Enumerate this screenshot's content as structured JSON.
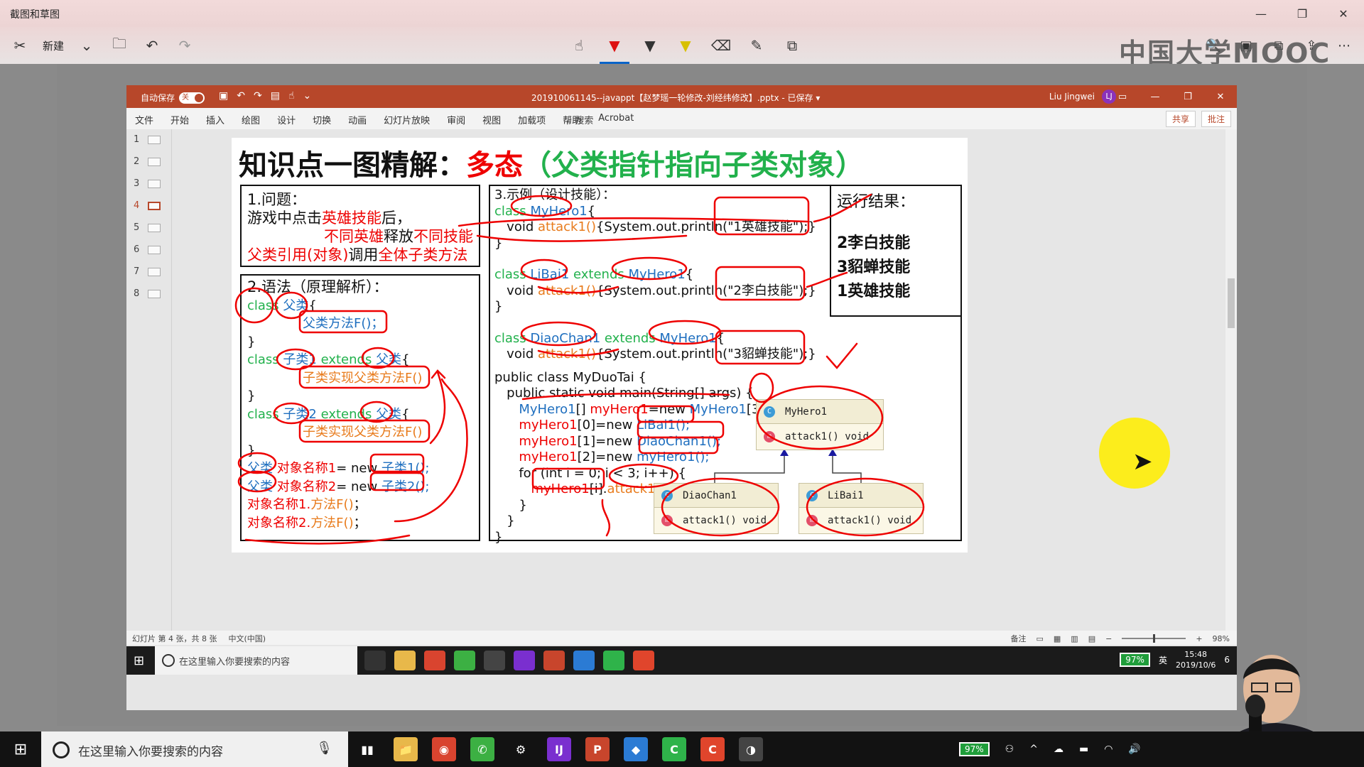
{
  "snip": {
    "title": "截图和草图",
    "new_label": "新建",
    "win_min": "—",
    "win_max": "❐",
    "win_close": "✕",
    "watermark": "中国大学MOOC",
    "icons": {
      "new": "✂",
      "chevron": "⌄",
      "folder": "🗀",
      "undo": "↶",
      "redo": "↷",
      "touch": "☝",
      "pen": "▼",
      "pencil": "▼",
      "highlighter": "▼",
      "eraser": "⌫",
      "ruler": "✎",
      "crop": "⧉",
      "zoom": "🔍",
      "save": "▣",
      "copy": "⧉",
      "share": "⇪",
      "more": "⋯"
    }
  },
  "ppt": {
    "autosave_label": "自动保存",
    "autosave_state": "关",
    "doc_name": "201910061145--javappt【赵梦瑶一轮修改-刘经纬修改】.pptx - 已保存 ▾",
    "user_name": "Liu Jingwei",
    "user_initial": "LJ",
    "ribbon_tabs": [
      "文件",
      "开始",
      "插入",
      "绘图",
      "设计",
      "切换",
      "动画",
      "幻灯片放映",
      "审阅",
      "视图",
      "加载项",
      "帮助",
      "Acrobat"
    ],
    "search_label": "搜索",
    "share_label": "共享",
    "comment_label": "批注",
    "thumbnails": [
      "1",
      "2",
      "3",
      "4",
      "5",
      "6",
      "7",
      "8"
    ],
    "active_slide": 4,
    "status_slide": "幻灯片 第 4 张，共 8 张",
    "status_lang": "中文(中国)",
    "status_notes": "备注",
    "zoom": "98%"
  },
  "slide": {
    "title_black": "知识点一图精解：",
    "title_red": "多态",
    "title_green": "（父类指针指向子类对象）",
    "box1": {
      "heading": "1.问题：",
      "l1_a": "游戏中点击",
      "l1_b": "英雄技能",
      "l1_c": "后，",
      "l2_a": "不同英雄",
      "l2_b": "释放",
      "l2_c": "不同技能",
      "l3_a": "父类引用(对象)",
      "l3_b": "调用",
      "l3_c": "全体子类方法"
    },
    "box2": {
      "heading": "2.语法（原理解析）：",
      "l1_kw": "class ",
      "l1_name": "父类",
      "l1_end": "{",
      "l2": "父类方法F()；",
      "l3": "}",
      "l4_kw": "class ",
      "l4_name": "子类1",
      "l4_ext": " extends ",
      "l4_parent": "父类",
      "l4_end": "{",
      "l5": "子类实现父类方法F()",
      "l6": "}",
      "l7_kw": "class ",
      "l7_name": "子类2",
      "l7_ext": " extends ",
      "l7_parent": "父类",
      "l7_end": "{",
      "l8": "子类实现父类方法F()",
      "l9": "}",
      "l10_a": "父类",
      "l10_b": " 对象名称1",
      "l10_c": "= new ",
      "l10_d": "子类1();",
      "l11_a": "父类",
      "l11_b": " 对象名称2",
      "l11_c": "= new ",
      "l11_d": "子类2();",
      "l12_a": "对象名称1.",
      "l12_b": "方法F()",
      "l12_c": "；",
      "l13_a": "对象名称2.",
      "l13_b": "方法F()",
      "l13_c": "；"
    },
    "box3": {
      "heading": "3.示例（设计技能）：",
      "c1_kw": "class ",
      "c1_name": "MyHero1",
      "c1_end": "{",
      "c1_m_kw": "   void ",
      "c1_m_name": "attack1()",
      "c1_m_body": "{System.out.println(\"1英雄技能\");}",
      "c1_close": "}",
      "c2_kw": "class ",
      "c2_name": "LiBai1",
      "c2_ext": " extends ",
      "c2_parent": "MyHero1",
      "c2_end": "{",
      "c2_m_kw": "   void ",
      "c2_m_name": "attack1()",
      "c2_m_body": "{System.out.println(\"2李白技能\");}",
      "c2_close": "}",
      "c3_kw": "class ",
      "c3_name": "DiaoChan1",
      "c3_ext": " extends ",
      "c3_parent": "MyHero1",
      "c3_end": "{",
      "c3_m_kw": "   void ",
      "c3_m_name": "attack1()",
      "c3_m_body": "{System.out.println(\"3貂蝉技能\");}",
      "m1": "public class MyDuoTai {",
      "m2": "   public static void main(String[] args) {",
      "m3_a": "      MyHero1",
      "m3_b": "[] ",
      "m3_c": "myHero1",
      "m3_d": "=new ",
      "m3_e": "MyHero1",
      "m3_f": "[3];",
      "m4_a": "      myHero1",
      "m4_b": "[0]=new ",
      "m4_c": "LiBai1();",
      "m5_a": "      myHero1",
      "m5_b": "[1]=new ",
      "m5_c": "DiaoChan1();",
      "m6_a": "      myHero1",
      "m6_b": "[2]=new ",
      "m6_c": "myHero1();",
      "m7": "      for (int i = 0; i < 3; i++) {",
      "m8_a": "         myHero1",
      "m8_b": "[i].",
      "m8_c": "attack1();",
      "m9": "      }",
      "m10": "   }",
      "m11": "}"
    },
    "result": {
      "heading": "运行结果：",
      "items": [
        "2李白技能",
        "3貂蝉技能",
        "1英雄技能"
      ]
    },
    "uml": {
      "myhero": "MyHero1",
      "diaochan": "DiaoChan1",
      "libai": "LiBai1",
      "method": "attack1() void",
      "class_badge": "C",
      "method_badge": "m"
    }
  },
  "inner_taskbar": {
    "search_placeholder": "在这里输入你要搜索的内容",
    "battery": "97%",
    "time": "15:48",
    "date": "2019/10/6",
    "ime": "英",
    "notif_count": "6"
  },
  "taskbar": {
    "search_placeholder": "在这里输入你要搜索的内容",
    "battery": "97%",
    "apps": [
      "▮▮",
      "📁",
      "◉",
      "✆",
      "⚙",
      "IJ",
      "P",
      "◆",
      "C",
      "C",
      "◑"
    ]
  },
  "colors": {
    "ppt_red": "#b7472a",
    "slide_red": "#e00000",
    "slide_green": "#22b14c",
    "code_blue": "#1f6fbf",
    "annotation_red": "#e00000",
    "highlight_yellow": "#ffee00"
  }
}
